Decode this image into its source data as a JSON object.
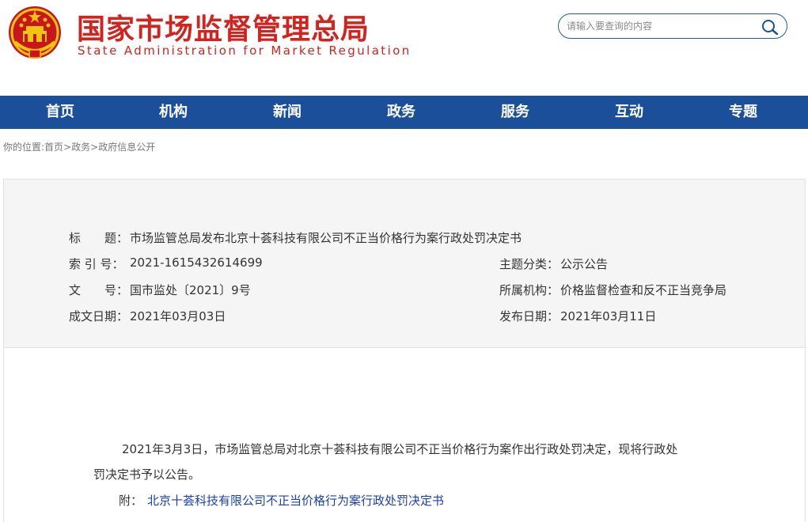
{
  "header": {
    "title_cn": "国家市场监督管理总局",
    "title_en": "State Administration for Market Regulation",
    "brand_color": "#d2231e",
    "emblem": "national-emblem"
  },
  "search": {
    "placeholder": "请输入要查询的内容",
    "icon": "search-icon"
  },
  "nav": {
    "color": "#1b4f9a",
    "items": [
      "首页",
      "机构",
      "新闻",
      "政务",
      "服务",
      "互动",
      "专题"
    ]
  },
  "breadcrumb": {
    "prefix": "你的位置:",
    "items": [
      "首页",
      "政务",
      "政府信息公开"
    ],
    "separator": ">"
  },
  "info": {
    "title_label": "标　　题：",
    "title_value": "市场监管总局发布北京十荟科技有限公司不正当价格行为案行政处罚决定书",
    "index_label": "索 引 号：",
    "index_value": "2021-1615432614699",
    "doc_label": "文　　号：",
    "doc_value": "国市监处〔2021〕9号",
    "date_label": "成文日期：",
    "date_value": "2021年03月03日",
    "topic_label": "主题分类：",
    "topic_value": "公示公告",
    "org_label": "所属机构：",
    "org_value": "价格监督检查和反不正当竞争局",
    "pub_label": "发布日期：",
    "pub_value": "2021年03月11日"
  },
  "content": {
    "para1_line1": "2021年3月3日，市场监管总局对北京十荟科技有限公司不正当价格行为案作出行政处罚决定，现将行政处",
    "para1_line2": "罚决定书予以公告。",
    "attach_label": "附：",
    "attach_link": "北京十荟科技有限公司不正当价格行为案行政处罚决定书",
    "link_color": "#1a3fb5"
  }
}
